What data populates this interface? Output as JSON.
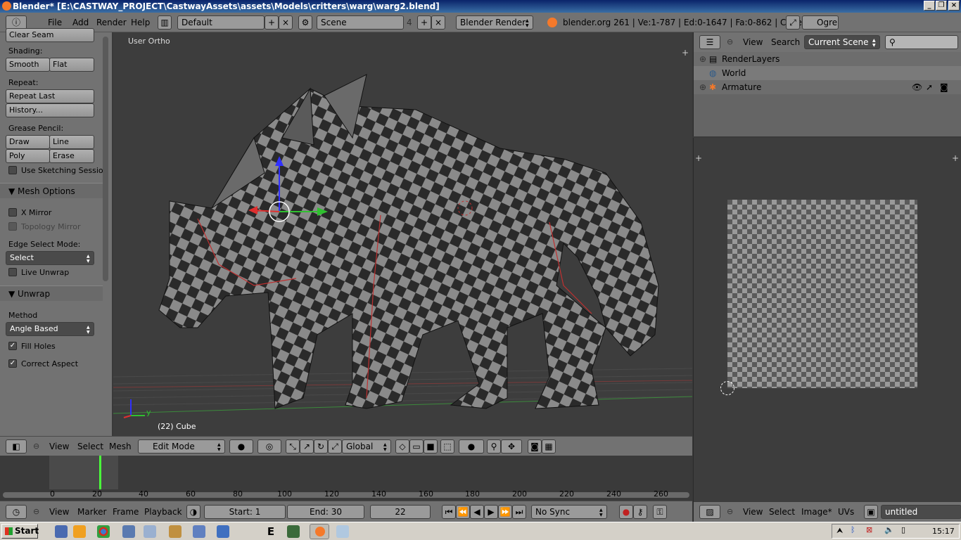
{
  "window": {
    "title": "Blender* [E:\\CASTWAY_PROJECT\\CastwayAssets\\assets\\Models\\critters\\warg\\warg2.blend]"
  },
  "info": {
    "menus": [
      "File",
      "Add",
      "Render",
      "Help"
    ],
    "layout": "Default",
    "scene": "Scene",
    "scene_users": "4",
    "engine": "Blender Render",
    "stats": "blender.org 261 | Ve:1-787 | Ed:0-1647 | Fa:0-862 | Cube",
    "ogre": "Ogre"
  },
  "toolshelf": {
    "clear_seam": "Clear Seam",
    "shading_label": "Shading:",
    "smooth": "Smooth",
    "flat": "Flat",
    "repeat_label": "Repeat:",
    "repeat_last": "Repeat Last",
    "history": "History...",
    "grease_label": "Grease Pencil:",
    "draw": "Draw",
    "line": "Line",
    "poly": "Poly",
    "erase": "Erase",
    "use_sketching": "Use Sketching Sessio",
    "mesh_options": "Mesh Options",
    "x_mirror": "X Mirror",
    "topology_mirror": "Topology Mirror",
    "edge_select_label": "Edge Select Mode:",
    "edge_select_value": "Select",
    "live_unwrap": "Live Unwrap",
    "unwrap": "Unwrap",
    "method_label": "Method",
    "method_value": "Angle Based",
    "fill_holes": "Fill Holes",
    "correct_aspect": "Correct Aspect"
  },
  "viewport": {
    "view_label": "User Ortho",
    "object_label": "(22) Cube",
    "axis_y": "y"
  },
  "viewport_header": {
    "menus": [
      "View",
      "Select",
      "Mesh"
    ],
    "mode": "Edit Mode",
    "orientation": "Global"
  },
  "timeline": {
    "ticks": [
      "0",
      "20",
      "40",
      "60",
      "80",
      "100",
      "120",
      "140",
      "160",
      "180",
      "200",
      "220",
      "240",
      "260"
    ],
    "current_frame_fraction": 0.11
  },
  "timeline_header": {
    "menus": [
      "View",
      "Marker",
      "Frame",
      "Playback"
    ],
    "start": "Start: 1",
    "end": "End: 30",
    "frame": "22",
    "sync": "No Sync"
  },
  "outliner": {
    "menus": [
      "View",
      "Search"
    ],
    "scope": "Current Scene",
    "rows": [
      "RenderLayers",
      "World",
      "Armature"
    ]
  },
  "uv_header": {
    "menus": [
      "View",
      "Select",
      "Image*",
      "UVs"
    ],
    "image": "untitled"
  },
  "taskbar": {
    "start": "Start",
    "clock": "15:17"
  },
  "colors": {
    "accent_green": "#4aff3a",
    "blender_orange": "#f5792a"
  }
}
